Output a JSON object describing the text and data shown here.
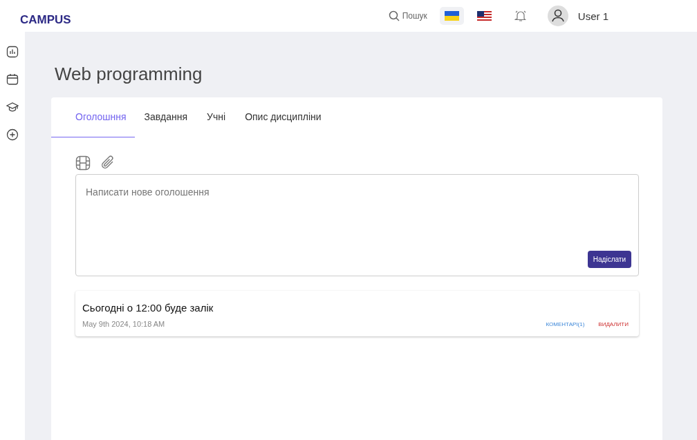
{
  "logo": {
    "text": "CAMPUS"
  },
  "header": {
    "search_label": "Пошук",
    "languages": [
      {
        "selected": true
      },
      {
        "selected": false
      }
    ],
    "user_name": "User 1"
  },
  "page_title": "Web programming",
  "tabs": [
    {
      "label": "Оголошння",
      "selected": true
    },
    {
      "label": "Завдання",
      "selected": false
    },
    {
      "label": "Учні",
      "selected": false
    },
    {
      "label": "Опис дисципліни",
      "selected": false
    }
  ],
  "composer": {
    "placeholder": "Написати нове оголошення",
    "submit": "Надіслати"
  },
  "posts": [
    {
      "text": "Сьогодні  о 12:00 буде залік",
      "date": "May 9th 2024, 10:18 AM",
      "comments": "КОМЕНТАРІ(1)",
      "delete": "ВИДАЛИТИ"
    }
  ]
}
